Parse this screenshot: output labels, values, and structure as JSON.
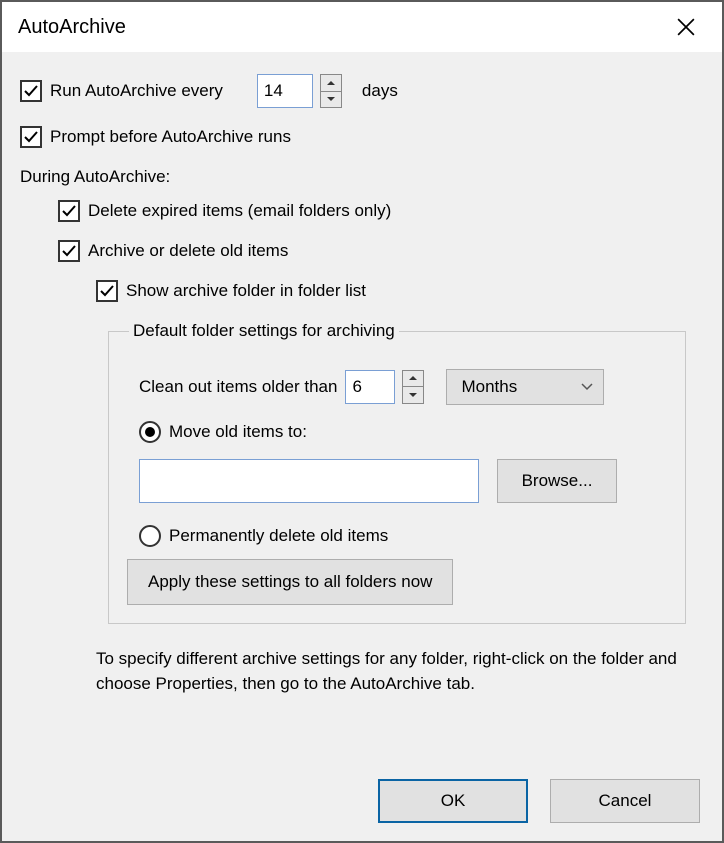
{
  "title": "AutoArchive",
  "run_every": {
    "checked": true,
    "label_before": "Run AutoArchive every",
    "value": "14",
    "label_after": "days"
  },
  "prompt": {
    "checked": true,
    "label": "Prompt before AutoArchive runs"
  },
  "during_heading": "During AutoArchive:",
  "delete_expired": {
    "checked": true,
    "label": "Delete expired items (email folders only)"
  },
  "archive_delete": {
    "checked": true,
    "label": "Archive or delete old items"
  },
  "show_folder": {
    "checked": true,
    "label": "Show archive folder in folder list"
  },
  "fieldset": {
    "legend": "Default folder settings for archiving",
    "clean_label": "Clean out items older than",
    "clean_value": "6",
    "clean_unit": "Months",
    "move_label": "Move old items to:",
    "move_path": "",
    "browse": "Browse...",
    "delete_label": "Permanently delete old items",
    "apply": "Apply these settings to all folders now",
    "radio_selection": "move"
  },
  "hint": "To specify different archive settings for any folder, right-click on the folder and choose Properties, then go to the AutoArchive tab.",
  "buttons": {
    "ok": "OK",
    "cancel": "Cancel"
  }
}
